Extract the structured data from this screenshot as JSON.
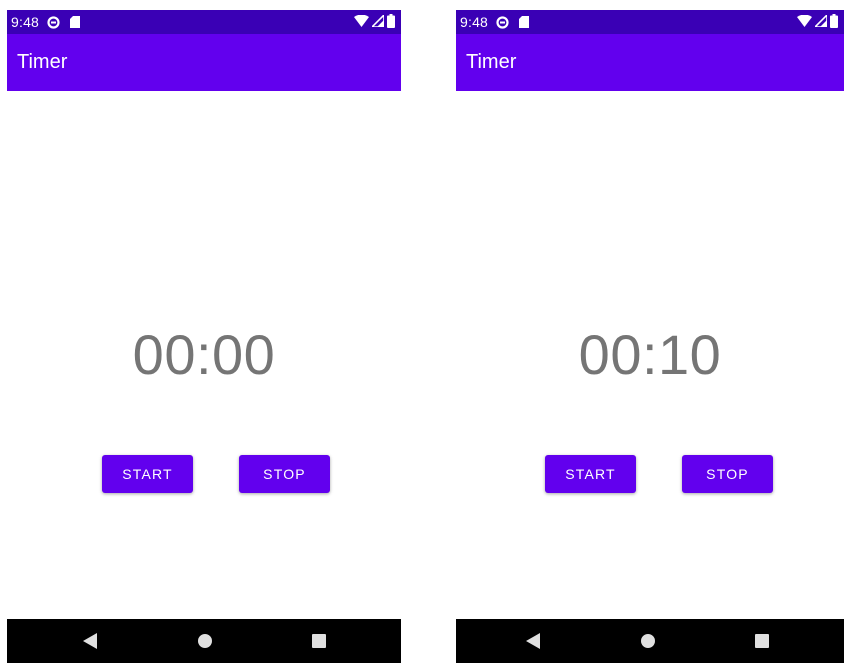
{
  "colors": {
    "status_bar": "#3a00b5",
    "app_bar": "#6200ee",
    "button": "#6200ee",
    "timer_text": "#757575",
    "nav_bar": "#000000"
  },
  "screens": [
    {
      "status_bar": {
        "time": "9:48",
        "left_icons": [
          "data-saver-icon",
          "sd-card-icon"
        ],
        "right_icons": [
          "wifi-icon",
          "signal-icon",
          "battery-icon"
        ]
      },
      "app_bar": {
        "title": "Timer"
      },
      "timer": {
        "display": "00:00"
      },
      "buttons": {
        "start_label": "START",
        "stop_label": "STOP"
      },
      "nav": [
        "back-icon",
        "home-icon",
        "recents-icon"
      ]
    },
    {
      "status_bar": {
        "time": "9:48",
        "left_icons": [
          "data-saver-icon",
          "sd-card-icon"
        ],
        "right_icons": [
          "wifi-icon",
          "signal-icon",
          "battery-icon"
        ]
      },
      "app_bar": {
        "title": "Timer"
      },
      "timer": {
        "display": "00:10"
      },
      "buttons": {
        "start_label": "START",
        "stop_label": "STOP"
      },
      "nav": [
        "back-icon",
        "home-icon",
        "recents-icon"
      ]
    }
  ]
}
